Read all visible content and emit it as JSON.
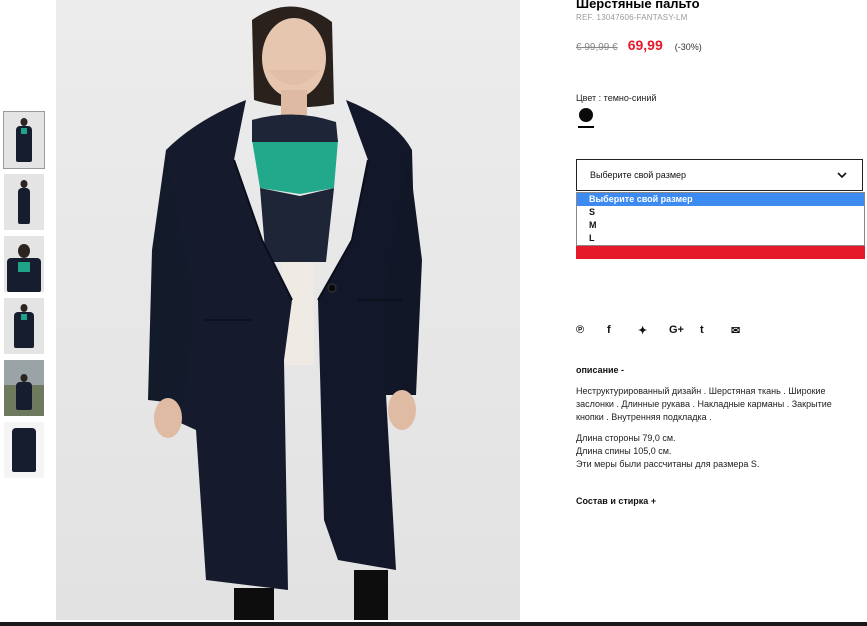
{
  "product": {
    "title": "Шерстяные пальто",
    "ref": "REF. 13047606-FANTASY-LM",
    "old_price": "€ 99,99 €",
    "new_price": "69,99",
    "discount": "(-30%)",
    "color_label": "Цвет : темно-синий",
    "color_value": "#0a0a0a"
  },
  "gallery": {
    "thumbnails": [
      "front",
      "full-body",
      "close-up",
      "side",
      "outdoor",
      "flat-lay"
    ],
    "active_index": 0
  },
  "size_select": {
    "label": "Выберите свой размер",
    "icon": "chevron-down-icon",
    "options": [
      "Выберите свой размер",
      "S",
      "M",
      "L"
    ],
    "highlighted": "Выберите свой размер"
  },
  "add_button": {
    "color": "#e6192b"
  },
  "share_icons": [
    "pinterest-icon",
    "facebook-icon",
    "twitter-icon",
    "google-plus-icon",
    "tumblr-icon",
    "email-icon"
  ],
  "share_glyphs": [
    "℗",
    "f",
    "✦",
    "G+",
    "t",
    "✉"
  ],
  "description": {
    "heading": "описание -",
    "text": "Неструктурированный дизайн . Шерстяная ткань . Широкие заслонки . Длинные рукава . Накладные карманы . Закрытие кнопки . Внутренняя подкладка .",
    "measure_1": "Длина стороны 79,0 см.",
    "measure_2": "Длина спины 105,0 см.",
    "measure_3": "Эти меры были рассчитаны для размера S."
  },
  "composition": {
    "heading": "Состав и стирка +"
  }
}
